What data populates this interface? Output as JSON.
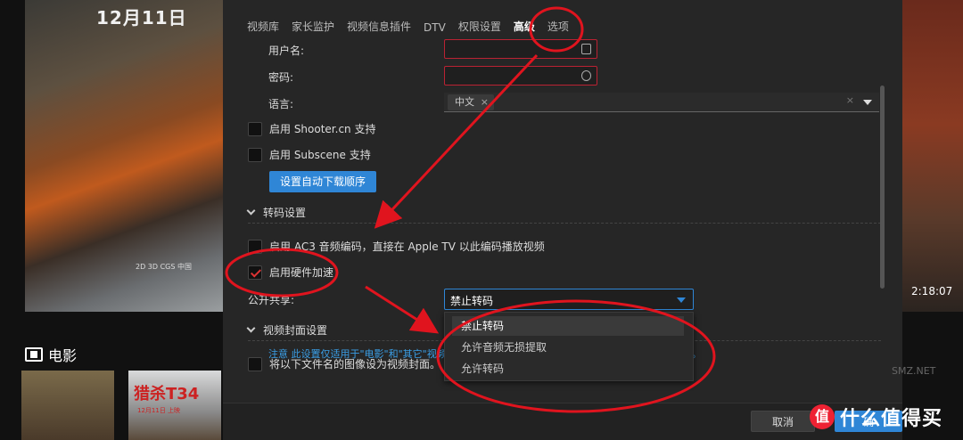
{
  "background": {
    "poster_date": "12月11日",
    "poster_bottom_text": "2D 3D CGS 中国",
    "duration": "2:18:07",
    "section_title": "电影",
    "thumb2_title": "猎杀T34",
    "thumb2_date": "12月11日 上映"
  },
  "tabs": [
    {
      "label": "视频库"
    },
    {
      "label": "家长监护"
    },
    {
      "label": "视频信息插件"
    },
    {
      "label": "DTV"
    },
    {
      "label": "权限设置"
    },
    {
      "label": "高级"
    },
    {
      "label": "选项"
    }
  ],
  "form": {
    "username_label": "用户名:",
    "password_label": "密码:",
    "language_label": "语言:",
    "language_chip": "中文",
    "language_clear": "×",
    "shooter_label": "启用 Shooter.cn 支持",
    "subscene_label": "启用 Subscene 支持",
    "download_order_button": "设置自动下载顺序",
    "transcode_section": "转码设置",
    "ac3_label": "启用 AC3 音频编码，直接在 Apple TV 以此编码播放视频",
    "hw_accel_label": "启用硬件加速",
    "public_share_label": "公开共享:",
    "public_share_value": "禁止转码",
    "cover_section": "视频封面设置",
    "cover_checkbox_label": "将以下文件名的图像设为视频封面。",
    "note_prefix": "注意",
    "note_text": "此设置仅适用于\"电影\"和\"其它\"视频类型。与视频有相同文件名的图像将优先被设为视频封面。"
  },
  "dropdown_options": [
    {
      "label": "禁止转码",
      "selected": true
    },
    {
      "label": "允许音频无损提取",
      "selected": false
    },
    {
      "label": "允许转码",
      "selected": false
    }
  ],
  "footer": {
    "cancel_label": "取消",
    "ok_label": "确"
  },
  "watermark": {
    "logo": "值",
    "text": "什么值得买",
    "faint_text": "SMZ.NET"
  },
  "colors": {
    "accent": "#2f86d6",
    "annotation_red": "#e0141e",
    "dialog_bg": "#262626"
  }
}
